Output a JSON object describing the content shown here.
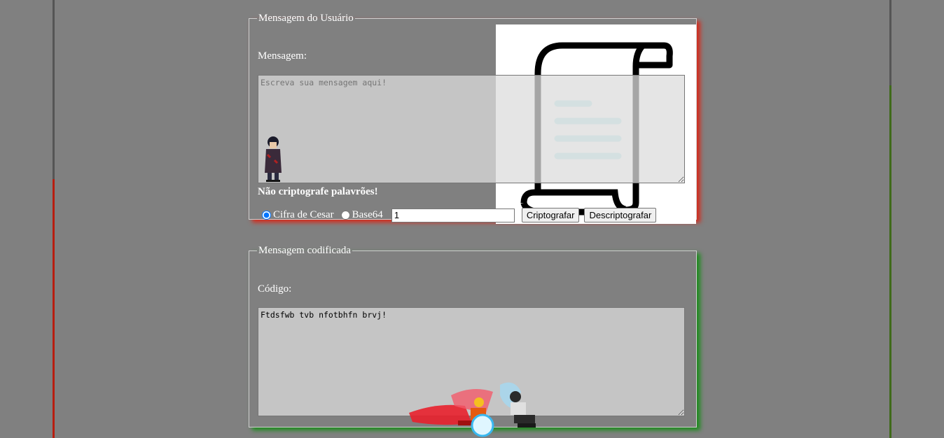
{
  "user_fieldset": {
    "legend": "Mensagem do Usuário",
    "message_label": "Mensagem:",
    "message_placeholder": "Escreva sua mensagem aqui!",
    "warning": "Não criptografe palavrões!",
    "option_caesar": "Cifra de Cesar",
    "option_base64": "Base64",
    "selected_option": "Cifra de Cesar",
    "key_value": "1",
    "encrypt_button": "Criptografar",
    "decrypt_button": "Descriptografar"
  },
  "coded_fieldset": {
    "legend": "Mensagem codificada",
    "code_label": "Código:",
    "code_value": "Ftdsfwb tvb nfotbhfn brvj!"
  },
  "icons": [
    "scroll-document-icon",
    "ninja-character-icon",
    "fighters-sprite-icon"
  ],
  "colors": {
    "background": "#808080",
    "user_shadow": "#d42a1c",
    "coded_shadow": "#1d8b1d",
    "scroll_lines": "#bdebee"
  }
}
